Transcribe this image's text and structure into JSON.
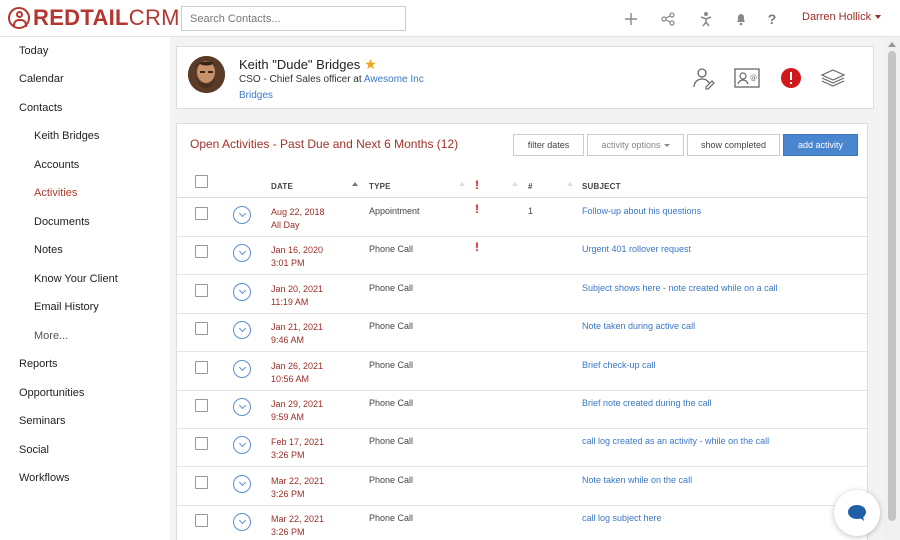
{
  "brand": {
    "name_bold": "REDTAIL",
    "name_light": "CRM",
    "color": "#b5362f"
  },
  "search": {
    "placeholder": "Search Contacts..."
  },
  "topbar": {
    "icons": [
      "plus-icon",
      "share-icon",
      "person-icon",
      "bell-icon",
      "help-icon"
    ],
    "help_label": "?",
    "user_name": "Darren Hollick"
  },
  "sidebar": {
    "items": [
      {
        "label": "Today"
      },
      {
        "label": "Calendar"
      },
      {
        "label": "Contacts"
      },
      {
        "label": "Keith Bridges"
      },
      {
        "label": "Accounts"
      },
      {
        "label": "Activities"
      },
      {
        "label": "Documents"
      },
      {
        "label": "Notes"
      },
      {
        "label": "Know Your Client"
      },
      {
        "label": "Email History"
      },
      {
        "label": "More..."
      },
      {
        "label": "Reports"
      },
      {
        "label": "Opportunities"
      },
      {
        "label": "Seminars"
      },
      {
        "label": "Social"
      },
      {
        "label": "Workflows"
      }
    ],
    "active_color": "#b03a2e"
  },
  "contact": {
    "name": "Keith \"Dude\" Bridges",
    "title_prefix": "CSO - Chief Sales officer at",
    "company": "Awesome Inc",
    "sub": "Bridges",
    "favorite": true,
    "icons": [
      "profile-edit-icon",
      "contact-card-icon",
      "alert-icon",
      "layers-icon"
    ]
  },
  "activities": {
    "title": "Open Activities - Past Due and Next 6 Months (12)",
    "buttons": {
      "filter_dates": "filter dates",
      "activity_options": "activity options",
      "show_completed": "show completed",
      "add_activity": "add activity"
    },
    "columns": {
      "date": "DATE",
      "type": "TYPE",
      "priority": "!",
      "num": "#",
      "subject": "SUBJECT"
    },
    "rows": [
      {
        "date": "Aug 22, 2018",
        "time": "All Day",
        "type": "Appointment",
        "priority": true,
        "num": "1",
        "subject": "Follow-up about his questions"
      },
      {
        "date": "Jan 16, 2020",
        "time": "3:01 PM",
        "type": "Phone Call",
        "priority": true,
        "num": "",
        "subject": "Urgent 401 rollover request"
      },
      {
        "date": "Jan 20, 2021",
        "time": "11:19 AM",
        "type": "Phone Call",
        "priority": false,
        "num": "",
        "subject": "Subject shows here - note created while on a call"
      },
      {
        "date": "Jan 21, 2021",
        "time": "9:46 AM",
        "type": "Phone Call",
        "priority": false,
        "num": "",
        "subject": "Note taken during active call"
      },
      {
        "date": "Jan 26, 2021",
        "time": "10:56 AM",
        "type": "Phone Call",
        "priority": false,
        "num": "",
        "subject": "Brief check-up call"
      },
      {
        "date": "Jan 29, 2021",
        "time": "9:59 AM",
        "type": "Phone Call",
        "priority": false,
        "num": "",
        "subject": "Brief note created during the call"
      },
      {
        "date": "Feb 17, 2021",
        "time": "3:26 PM",
        "type": "Phone Call",
        "priority": false,
        "num": "",
        "subject": "call log created as an activity - while on the call"
      },
      {
        "date": "Mar 22, 2021",
        "time": "3:26 PM",
        "type": "Phone Call",
        "priority": false,
        "num": "",
        "subject": "Note taken while on the call"
      },
      {
        "date": "Mar 22, 2021",
        "time": "3:26 PM",
        "type": "Phone Call",
        "priority": false,
        "num": "",
        "subject": "call log subject here"
      }
    ]
  },
  "chat": {
    "icon": "chat-bubble-icon",
    "color": "#1f5fa8"
  }
}
